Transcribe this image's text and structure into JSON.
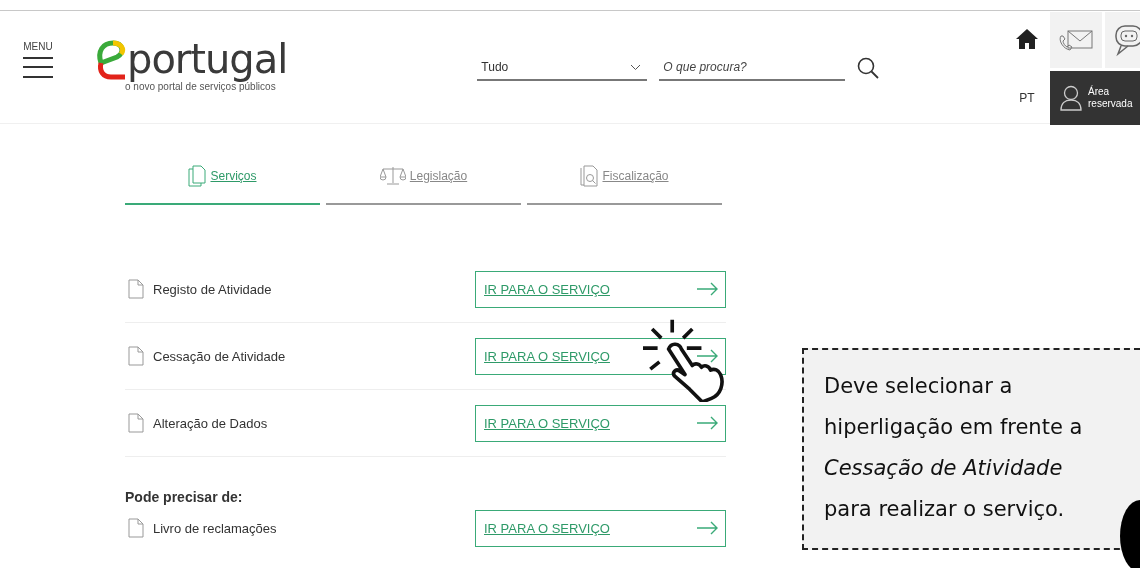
{
  "header": {
    "menu_label": "MENU",
    "logo_text": "portugal",
    "logo_tagline": "o novo portal de serviços públicos",
    "search_scope": "Tudo",
    "search_placeholder": "O que procura?",
    "language": "PT",
    "account_label": "Área reservada"
  },
  "tabs": [
    {
      "label": "Serviços",
      "selected": true,
      "kind": "documents"
    },
    {
      "label": "Legislação",
      "selected": false,
      "kind": "scales"
    },
    {
      "label": "Fiscalização",
      "selected": false,
      "kind": "inspection"
    }
  ],
  "services": [
    {
      "name": "Registo de Atividade",
      "action": "IR PARA O SERVIÇO"
    },
    {
      "name": "Cessação de Atividade",
      "action": "IR PARA O SERVIÇO"
    },
    {
      "name": "Alteração de Dados",
      "action": "IR PARA O SERVIÇO"
    }
  ],
  "related": {
    "heading": "Pode precisar de:",
    "services": [
      {
        "name": "Livro de reclamações",
        "action": "IR PARA O SERVIÇO"
      }
    ]
  },
  "callout": {
    "text": "Deve selecionar a hiperligação em frente a *Cessação de Atividade* para realizar o serviço."
  }
}
